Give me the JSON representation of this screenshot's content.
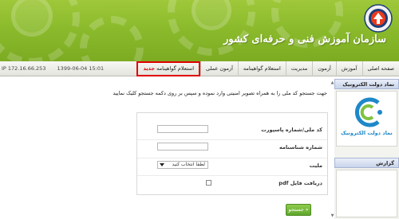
{
  "header": {
    "title": "سازمان آموزش فنی و حرفه‌ای کشور",
    "colors": {
      "header_bg": "#8bbb2c",
      "highlight_border": "#e00000"
    }
  },
  "nav": {
    "items": [
      {
        "label": "صفحه اصلی",
        "icon": "none"
      },
      {
        "label": "آموزش"
      },
      {
        "label": "آزمون"
      },
      {
        "label": "مدیریت"
      },
      {
        "label": "استعلام گواهینامه"
      },
      {
        "label": "آزمون عملی"
      },
      {
        "label": "استعلام گواهینامه",
        "badge": "جدید",
        "highlighted": true
      }
    ],
    "datetime": "1399-06-04 15:01",
    "ip": "IP 172.16.66.253"
  },
  "sidebar": {
    "egov_panel_title": "نماد دولت الکترونیک",
    "egov_caption": "نماد دولت الکترونیک",
    "report_panel_title": "گزارش"
  },
  "main": {
    "instruction": "جهت جستجو کد ملی را به همراه تصویر امنیتی وارد نموده و سپس بر روی دکمه جستجو کلیک نمایید",
    "form": {
      "national_id_label": "کد ملی/شماره پاسپورت",
      "national_id_value": "",
      "id_number_label": "شماره شناسنامه",
      "id_number_value": "",
      "nationality_label": "ملیت",
      "nationality_selected": "لطفا انتخاب کنید",
      "pdf_label": "دریافت فایل pdf",
      "pdf_checked": false
    },
    "search_button": "جستجو"
  }
}
